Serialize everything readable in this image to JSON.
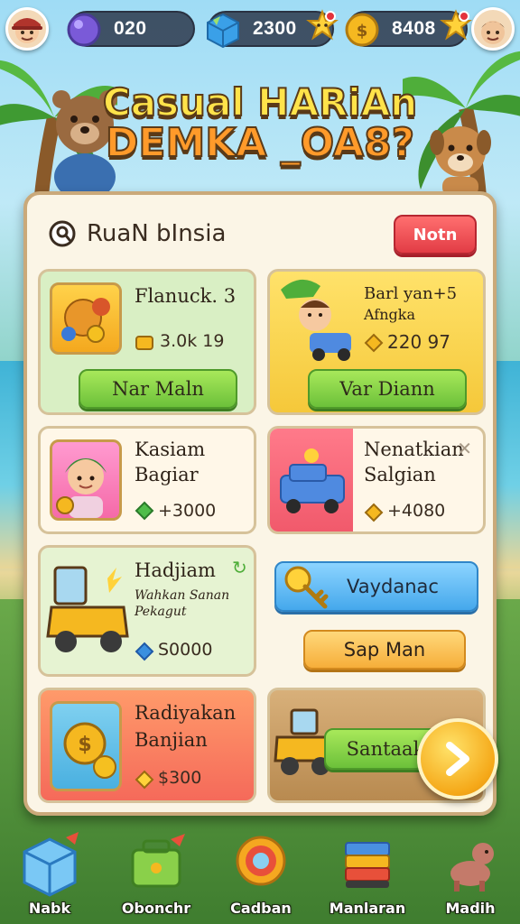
{
  "top_bar": {
    "gems": "020",
    "cash": "2300",
    "coins": "8408"
  },
  "title": {
    "line1": "Casual HARiAn",
    "line2": "DEMKA _OA8?"
  },
  "panel": {
    "title": "RuaN bInsia",
    "header_button": "Notn"
  },
  "cards": [
    {
      "name": "Flanuck. 3",
      "price": "3.0k 19",
      "button": "Nar Maln"
    },
    {
      "name_line1": "Barl yan+5",
      "name_line2": "Afngka",
      "price": "220 97",
      "button": "Var Diann"
    },
    {
      "name_line1": "Kasiam",
      "name_line2": "Bagiar",
      "price": "+3000"
    },
    {
      "name_line1": "Nenatkian",
      "name_line2": "Salgian",
      "price": "+4080"
    },
    {
      "name": "Hadjiam",
      "desc_line1": "Wahkan Sanan",
      "desc_line2": "Pekagut",
      "price": "S0000"
    },
    {
      "button_top": "Vaydanac",
      "button_bottom": "Sap Man"
    },
    {
      "name_line1": "Radiyakan",
      "name_line2": "Banjian",
      "price": "$300"
    },
    {
      "button": "Santaak"
    }
  ],
  "nav": [
    {
      "label": "Nabk"
    },
    {
      "label": "Obonchr"
    },
    {
      "label": "Cadban"
    },
    {
      "label": "Manlaran"
    },
    {
      "label": "Madih"
    }
  ],
  "colors": {
    "panel_bg": "#fbf5e6",
    "green_button": "#6cc13a",
    "red_button": "#e23c45",
    "blue_button": "#45a8ec",
    "gold": "#f5a818"
  }
}
